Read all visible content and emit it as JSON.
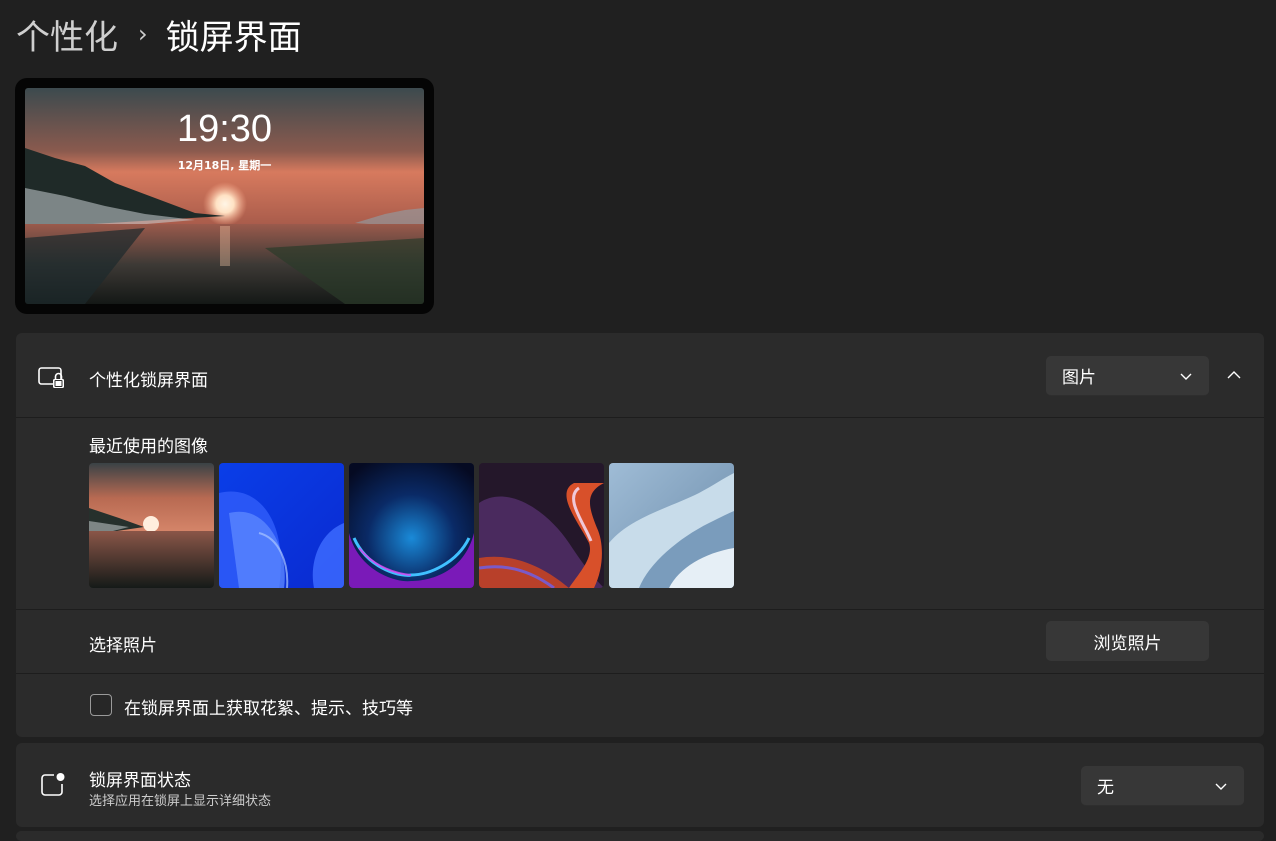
{
  "breadcrumb": {
    "parent": "个性化",
    "separator": "›",
    "current": "锁屏界面"
  },
  "preview": {
    "time": "19:30",
    "date": "12月18日, 星期一"
  },
  "personalize": {
    "label": "个性化锁屏界面",
    "dropdown_value": "图片",
    "recent_images_label": "最近使用的图像",
    "recent_images": [
      "sunset-lake",
      "blue-bloom",
      "blue-purple-orb",
      "purple-orange-ribbon",
      "light-blue-bloom"
    ],
    "choose_photo_label": "选择照片",
    "browse_button": "浏览照片",
    "tips_checkbox_label": "在锁屏界面上获取花絮、提示、技巧等",
    "tips_checked": false
  },
  "status": {
    "label": "锁屏界面状态",
    "sublabel": "选择应用在锁屏上显示详细状态",
    "dropdown_value": "无"
  },
  "icons": {
    "lock_screen": "monitor-lock-icon",
    "status": "app-badge-icon",
    "dropdown": "chevron-down-icon",
    "collapse": "chevron-up-icon"
  }
}
